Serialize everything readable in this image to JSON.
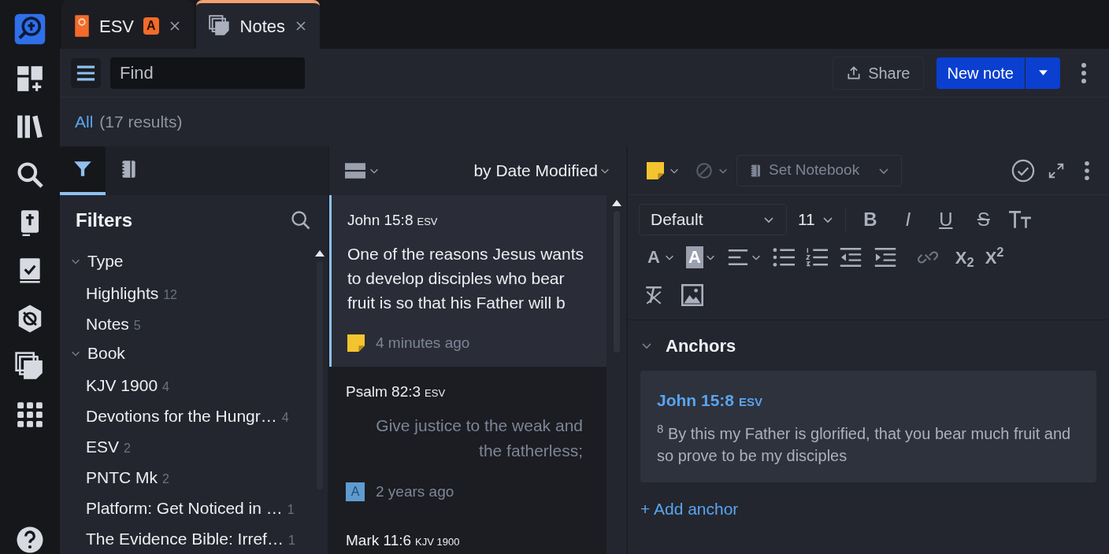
{
  "tabs": [
    {
      "label": "ESV",
      "kind": "book",
      "badge": "A",
      "selected": false
    },
    {
      "label": "Notes",
      "kind": "notes",
      "selected": true
    }
  ],
  "toolbar": {
    "search": {
      "placeholder": "Find"
    },
    "share": "Share",
    "new_note": "New note"
  },
  "results": {
    "scope": "All",
    "count": "(17 results)"
  },
  "filters": {
    "tabs": [
      {
        "kind": "filter",
        "selected": true
      },
      {
        "kind": "notebook",
        "selected": false
      }
    ],
    "title": "Filters",
    "groups": [
      {
        "label": "Type",
        "expanded": true,
        "children": [
          {
            "label": "Highlights",
            "count": "12"
          },
          {
            "label": "Notes",
            "count": "5"
          }
        ]
      },
      {
        "label": "Book",
        "expanded": true,
        "children": [
          {
            "label": "KJV 1900",
            "count": "4"
          },
          {
            "label": "Devotions for the Hungr…",
            "count": "4"
          },
          {
            "label": "ESV",
            "count": "2"
          },
          {
            "label": "PNTC Mk",
            "count": "2"
          },
          {
            "label": "Platform: Get Noticed in …",
            "count": "1"
          },
          {
            "label": "The Evidence Bible: Irref…",
            "count": "1"
          }
        ]
      }
    ]
  },
  "list": {
    "sort": "by Date Modified",
    "notes": [
      {
        "reference": "John 15:8",
        "version": "ESV",
        "kind": "note",
        "selected": true,
        "text": "One of the reasons Jesus wants to develop disciples who bear fruit is so that his Father will b",
        "time": "4 minutes ago"
      },
      {
        "reference": "Psalm 82:3",
        "version": "ESV",
        "kind": "highlight",
        "selected": false,
        "text": "Give justice to the weak and the fatherless;",
        "style_label": "A",
        "time": "2 years ago"
      },
      {
        "reference": "Mark 11:6",
        "version": "KJV 1900",
        "selected": false
      }
    ]
  },
  "editor": {
    "notebook": "Set Notebook",
    "font": "Default",
    "size": "11",
    "format_buttons": [
      {
        "kind": "bold",
        "label": "B"
      },
      {
        "kind": "italic",
        "label": "I"
      },
      {
        "kind": "underline",
        "label": "U"
      },
      {
        "kind": "strike",
        "label": "S"
      }
    ],
    "color_buttons": [
      {
        "kind": "text",
        "label": "A"
      },
      {
        "kind": "highlight",
        "label": "A"
      }
    ],
    "script_buttons": [
      {
        "label": "X$_{2}$"
      },
      {
        "label": "X$^{2}$"
      }
    ],
    "anchors": {
      "title": "Anchors",
      "expanded": true,
      "items": [
        {
          "reference": "John 15:8",
          "version": "ESV",
          "text": "$^{8}$ By this my Father is glorified, that you bear much fruit and so prove to be my disciples"
        }
      ],
      "add": "+ Add anchor"
    }
  }
}
